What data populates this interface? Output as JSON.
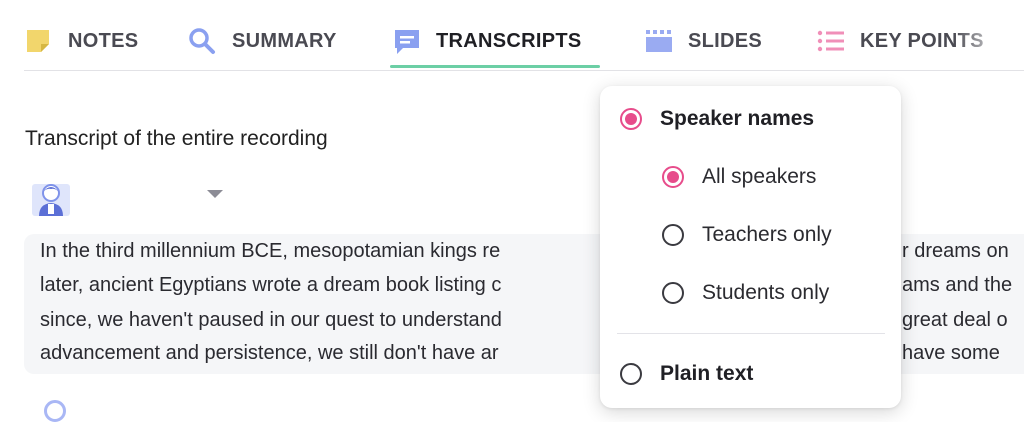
{
  "tabs": [
    {
      "label": "NOTES",
      "icon": "sticky-note-icon"
    },
    {
      "label": "SUMMARY",
      "icon": "search-icon"
    },
    {
      "label": "TRANSCRIPTS",
      "icon": "chat-bubble-icon",
      "active": true
    },
    {
      "label": "SLIDES",
      "icon": "slides-icon"
    },
    {
      "label": "KEY POINTS",
      "icon": "list-icon"
    }
  ],
  "content": {
    "title": "Transcript of the entire recording",
    "transcript_lines": [
      " In the third millennium BCE, mesopotamian kings re",
      "later, ancient Egyptians wrote a dream book listing c",
      "since, we haven't paused in our quest to understand",
      "advancement and persistence, we still don't have ar"
    ],
    "transcript_right_fragments": [
      "r dreams on",
      "ams and the",
      "great deal o",
      "have some"
    ]
  },
  "dropdown": {
    "speaker_names": "Speaker names",
    "options": [
      "All speakers",
      "Teachers only",
      "Students only"
    ],
    "selected": "All speakers",
    "plain_text": "Plain text"
  },
  "colors": {
    "accent_pink": "#e74c8b",
    "tab_underline": "#6ccfa5",
    "icon_blue": "#8aa0f0",
    "note_yellow": "#f2d66c"
  }
}
